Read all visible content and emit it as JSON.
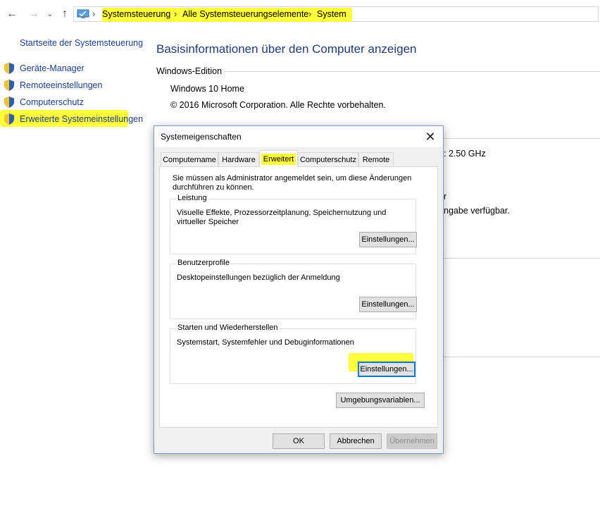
{
  "address": {
    "crumbs": [
      "Systemsteuerung",
      "Alle Systemsteuerungselemente",
      "System"
    ]
  },
  "left_pane": {
    "home": "Startseite der Systemsteuerung",
    "links": [
      "Geräte-Manager",
      "Remoteeinstellungen",
      "Computerschutz",
      "Erweiterte Systemeinstellungen"
    ]
  },
  "main": {
    "title": "Basisinformationen über den Computer anzeigen",
    "edition_label": "Windows-Edition",
    "edition": "Windows 10 Home",
    "copyright": "© 2016 Microsoft Corporation. Alle Rechte vorbehalten.",
    "partial_ghz": ":  2.50 GHz",
    "partial_r": "r",
    "partial_input": "ngabe verfügbar."
  },
  "dialog": {
    "title": "Systemeigenschaften",
    "tabs": [
      "Computername",
      "Hardware",
      "Erweitert",
      "Computerschutz",
      "Remote"
    ],
    "active_tab": "Erweitert",
    "admin_note": "Sie müssen als Administrator angemeldet sein, um diese Änderungen durchführen zu können.",
    "groups": [
      {
        "title": "Leistung",
        "desc": "Visuelle Effekte, Prozessorzeitplanung, Speichernutzung und virtueller Speicher",
        "button": "Einstellungen..."
      },
      {
        "title": "Benutzerprofile",
        "desc": "Desktopeinstellungen bezüglich der Anmeldung",
        "button": "Einstellungen..."
      },
      {
        "title": "Starten und Wiederherstellen",
        "desc": "Systemstart, Systemfehler und Debuginformationen",
        "button": "Einstellungen..."
      }
    ],
    "env_button": "Umgebungsvariablen...",
    "ok": "OK",
    "cancel": "Abbrechen",
    "apply": "Übernehmen"
  },
  "colors": {
    "highlight": "#ffff3b",
    "link": "#1a3f8c",
    "title": "#1e3c78",
    "focus": "#0078d7"
  }
}
